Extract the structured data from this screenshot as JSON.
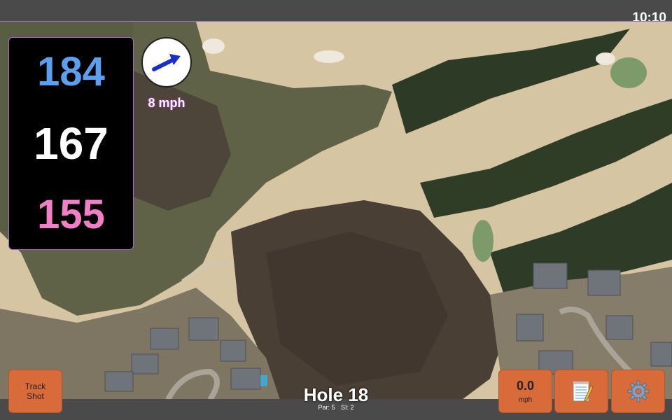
{
  "status": {
    "time": "10:10"
  },
  "distances": {
    "back": "184",
    "middle": "167",
    "front": "155"
  },
  "wind": {
    "speed": "8 mph",
    "icon": "wind-direction-arrow-icon"
  },
  "buttons": {
    "track_shot_line1": "Track",
    "track_shot_line2": "Shot",
    "speed_value": "0.0",
    "speed_unit": "mph",
    "notes_icon": "notepad-icon",
    "settings_icon": "gear-icon"
  },
  "hole": {
    "title": "Hole 18",
    "par": "Par: 5",
    "si": "SI: 2"
  },
  "colors": {
    "back": "#5aa0ee",
    "middle": "#ffffff",
    "front": "#f17fc6",
    "button": "#d96b3b",
    "panel_border": "#b060d0"
  }
}
